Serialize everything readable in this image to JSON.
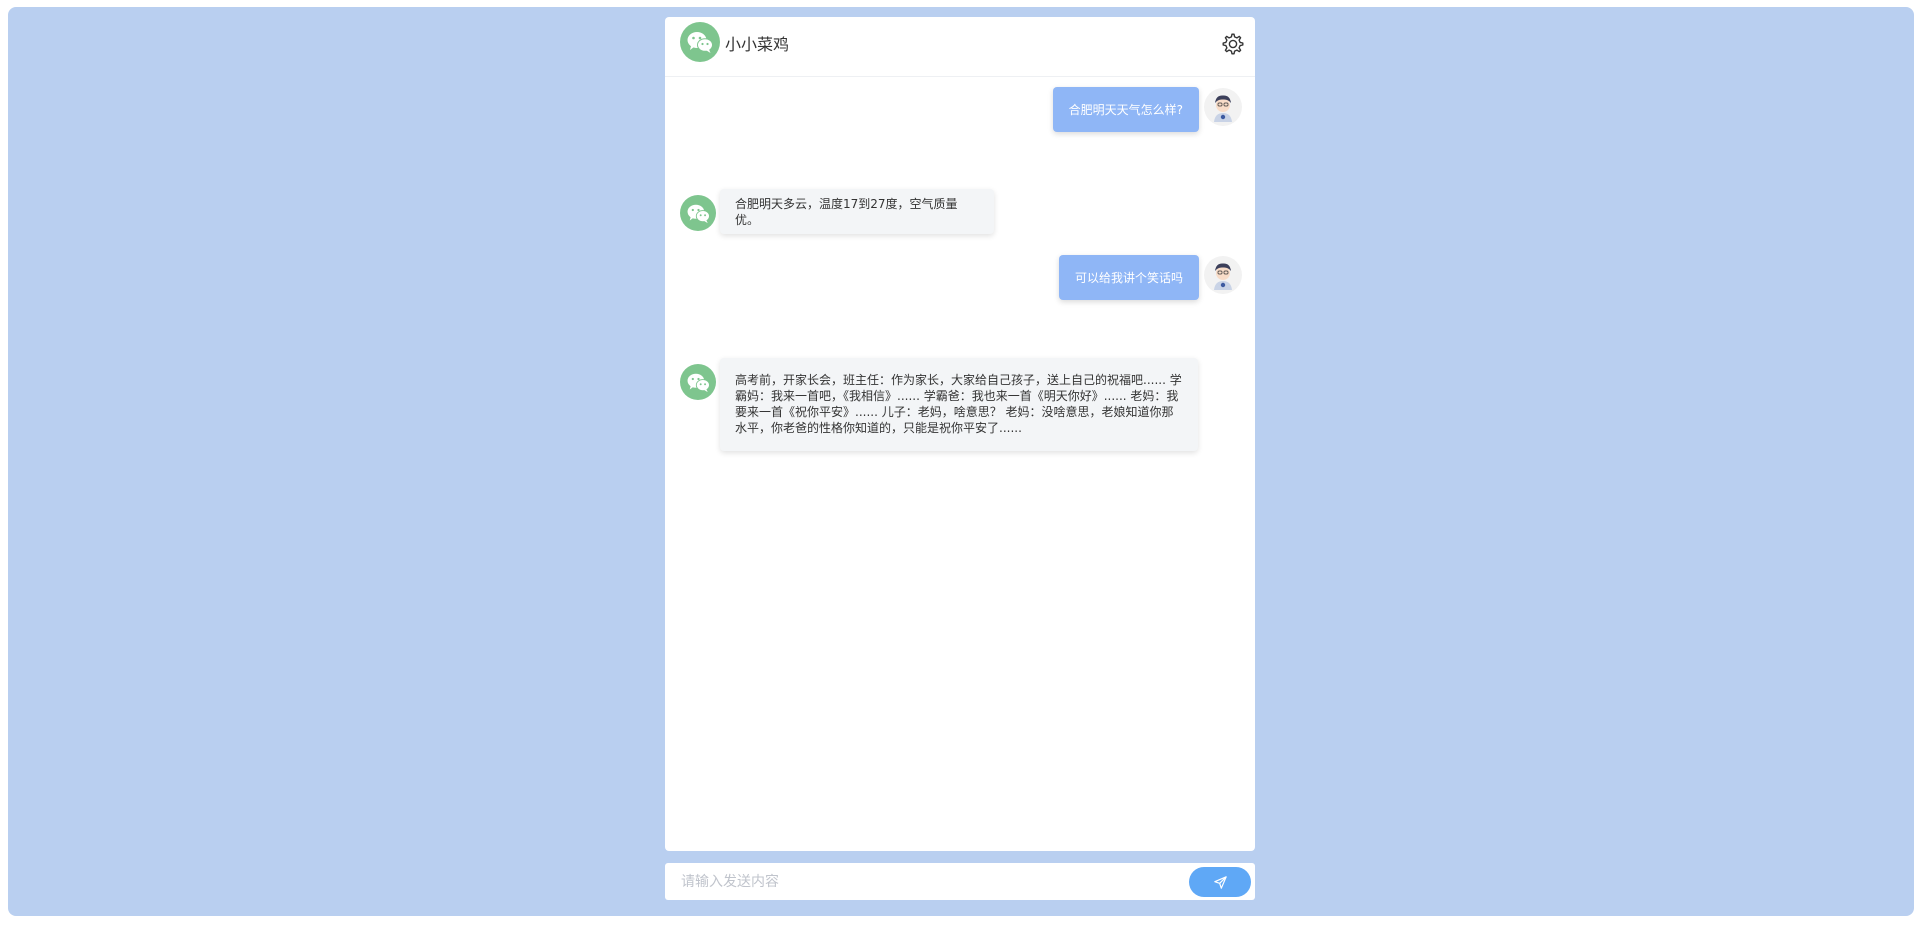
{
  "header": {
    "title": "小小菜鸡",
    "bot_avatar_icon": "wechat-icon",
    "settings_icon": "gear-icon"
  },
  "messages": [
    {
      "role": "user",
      "text": "合肥明天天气怎么样?"
    },
    {
      "role": "bot",
      "text": "合肥明天多云，温度17到27度，空气质量优。"
    },
    {
      "role": "user",
      "text": "可以给我讲个笑话吗"
    },
    {
      "role": "bot",
      "text": "高考前，开家长会，班主任：作为家长，大家给自己孩子，送上自己的祝福吧...... 学霸妈：我来一首吧，《我相信》...... 学霸爸：我也来一首《明天你好》...... 老妈：我要来一首《祝你平安》...... 儿子：老妈，啥意思？ 老妈：没啥意思，老娘知道你那水平，你老爸的性格你知道的，只能是祝你平安了......"
    }
  ],
  "input": {
    "placeholder": "请输入发送内容",
    "value": ""
  },
  "send_icon": "send-icon",
  "colors": {
    "background": "#b9cff0",
    "user_bubble": "#8fb6f6",
    "bot_bubble": "#f3f5f7",
    "bot_avatar": "#7ec58e",
    "send_button": "#5fa8f6"
  }
}
